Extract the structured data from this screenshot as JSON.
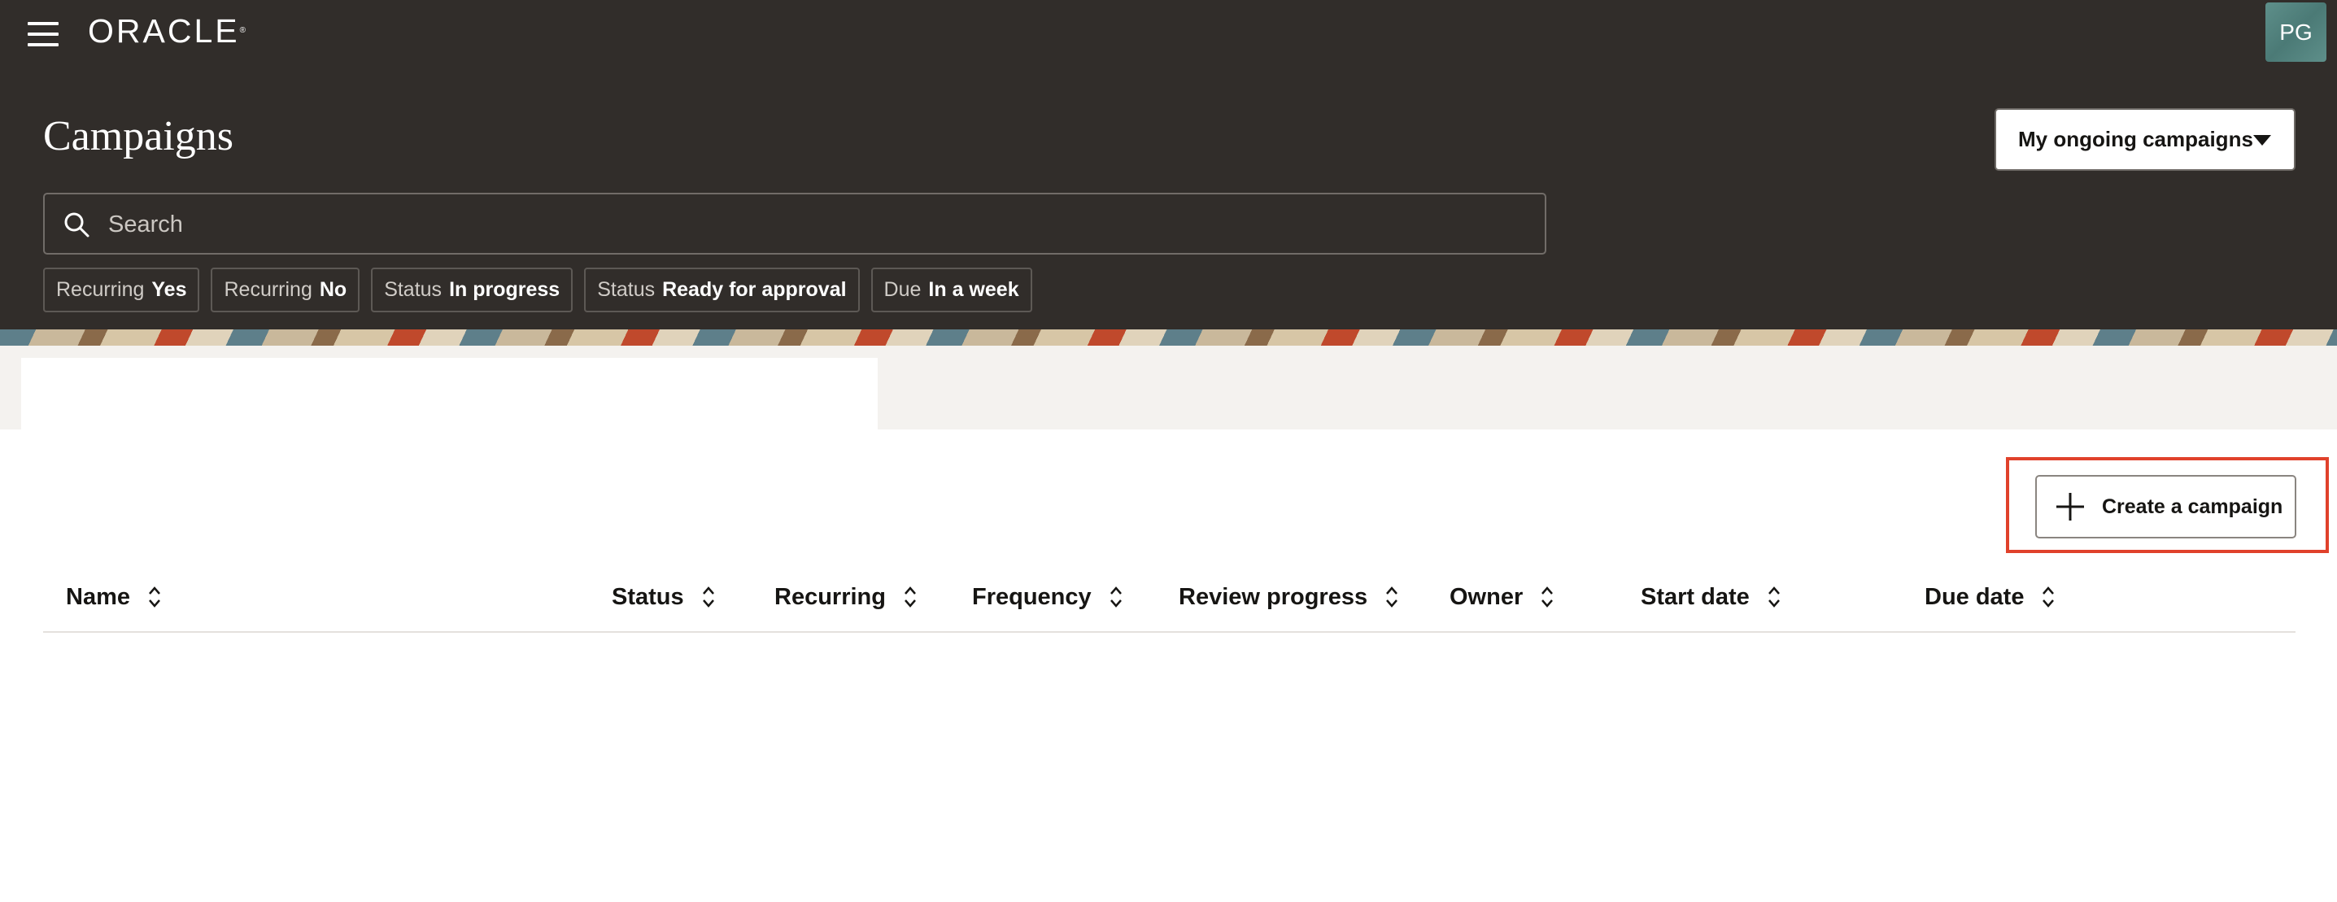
{
  "header": {
    "logo_text": "ORACLE",
    "avatar_initials": "PG",
    "page_title": "Campaigns",
    "view_selector": "My ongoing campaigns"
  },
  "search": {
    "placeholder": "Search"
  },
  "filters": [
    {
      "key": "Recurring",
      "value": "Yes"
    },
    {
      "key": "Recurring",
      "value": "No"
    },
    {
      "key": "Status",
      "value": "In progress"
    },
    {
      "key": "Status",
      "value": "Ready for approval"
    },
    {
      "key": "Due",
      "value": "In a week"
    }
  ],
  "actions": {
    "create_label": "Create a campaign"
  },
  "table": {
    "columns": [
      "Name",
      "Status",
      "Recurring",
      "Frequency",
      "Review progress",
      "Owner",
      "Start date",
      "Due date"
    ]
  },
  "colors": {
    "header_bg": "#312d2a",
    "highlight": "#e0412b",
    "avatar_bg": "#5e8f8a"
  }
}
